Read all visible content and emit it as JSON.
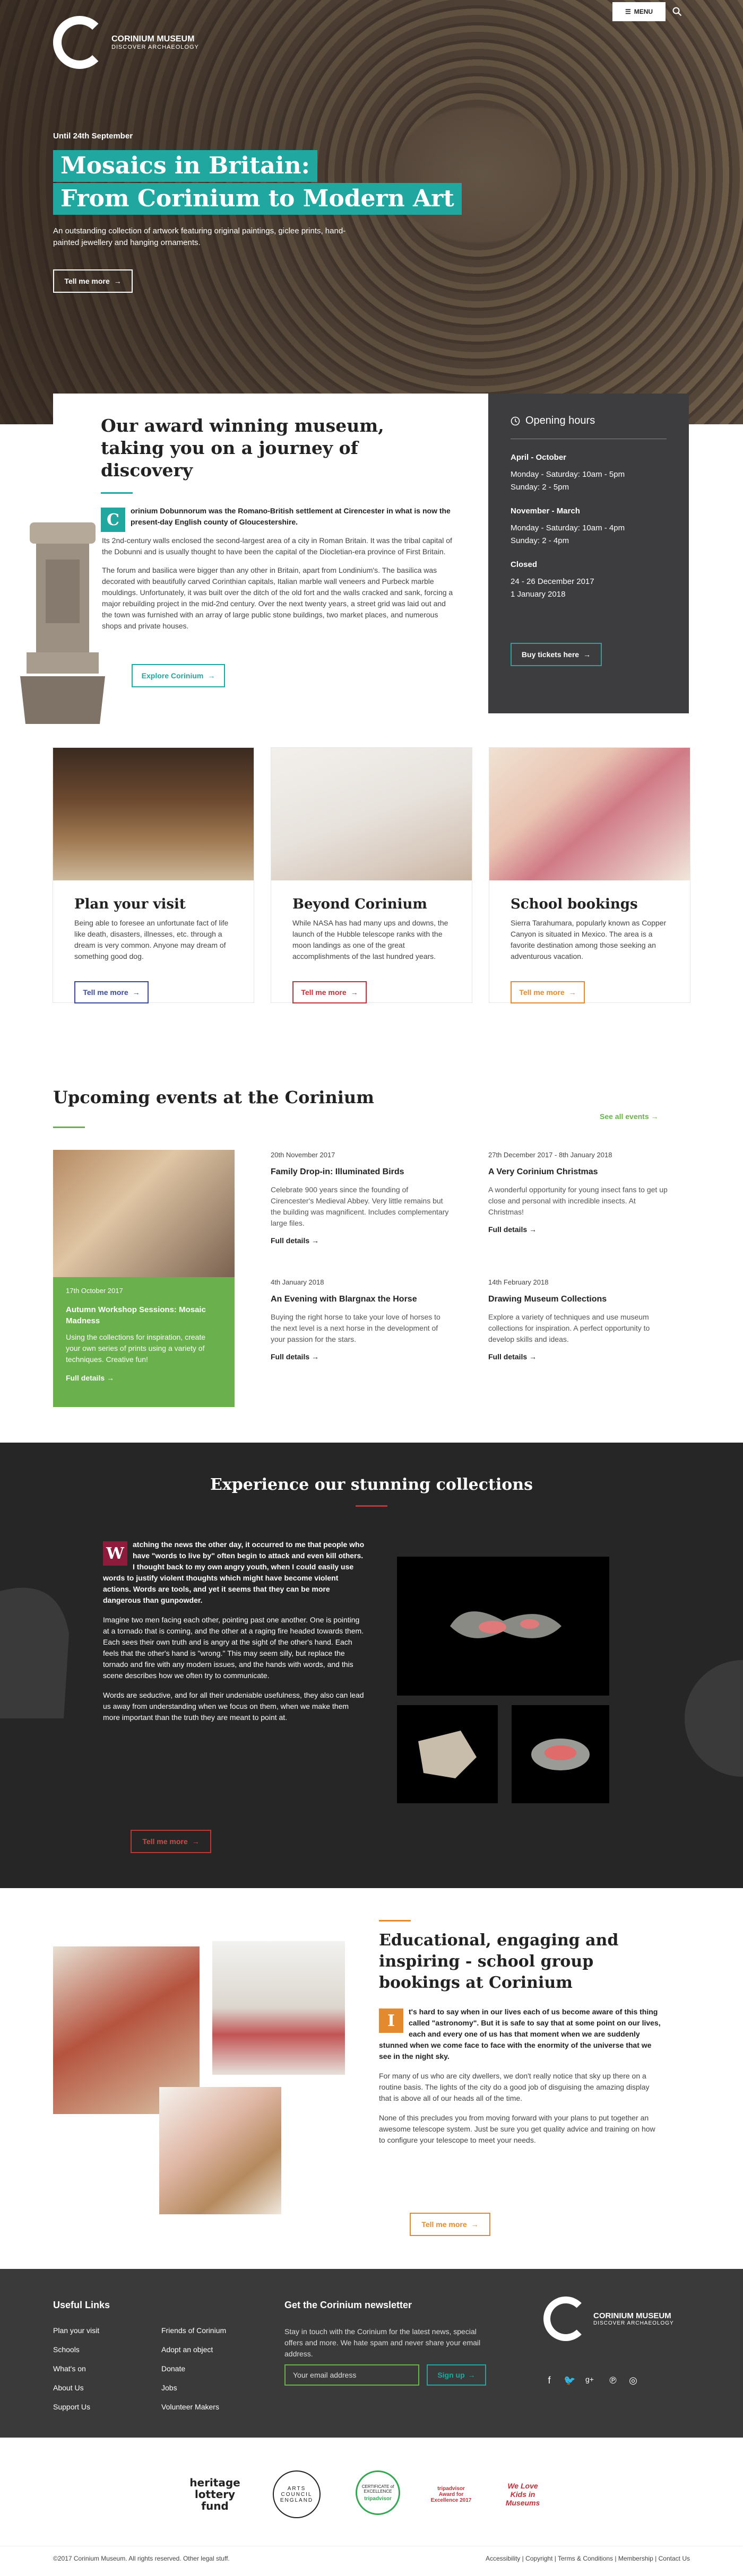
{
  "header": {
    "logo_title": "CORINIUM MUSEUM",
    "logo_subtitle": "DISCOVER ARCHAEOLOGY",
    "menu_label": "MENU"
  },
  "hero": {
    "date": "Until 24th September",
    "title_line1": "Mosaics in Britain:",
    "title_line2": "From Corinium to Modern Art",
    "description": "An outstanding collection of artwork featuring original paintings, giclee prints, hand-painted jewellery and hanging ornaments.",
    "button": "Tell me more"
  },
  "intro": {
    "heading": "Our award winning museum, taking you on a journey of discovery",
    "dropcap": "C",
    "lead": "orinium Dobunnorum was the Romano-British settlement at Cirencester in what is now the present-day English county of Gloucestershire.",
    "p2": "Its 2nd-century walls enclosed the second-largest area of a city in Roman Britain. It was the tribal capital of the Dobunni and is usually thought to have been the capital of the Diocletian-era province of First Britain.",
    "p3": "The forum and basilica were bigger than any other in Britain, apart from Londinium's. The basilica was decorated with beautifully carved Corinthian capitals, Italian marble wall veneers and Purbeck marble mouldings. Unfortunately, it was built over the ditch of the old fort and the walls cracked and sank, forcing a major rebuilding project in the mid-2nd century. Over the next twenty years, a street grid was laid out and the town was furnished with an array of large public stone buildings, two market places, and numerous shops and private houses.",
    "button": "Explore Corinium"
  },
  "hours": {
    "title": "Opening hours",
    "groups": [
      {
        "heading": "April - October",
        "lines": [
          "Monday - Saturday: 10am - 5pm",
          "Sunday: 2 - 5pm"
        ]
      },
      {
        "heading": "November - March",
        "lines": [
          "Monday - Saturday: 10am - 4pm",
          "Sunday: 2 - 4pm"
        ]
      },
      {
        "heading": "Closed",
        "lines": [
          "24 - 26 December 2017",
          "1 January 2018"
        ]
      }
    ],
    "button": "Buy tickets here"
  },
  "cards": [
    {
      "title": "Plan your visit",
      "text": "Being able to foresee an unfortunate fact of life like death, disasters, illnesses, etc. through a dream is very common. Anyone may dream of something good dog.",
      "button": "Tell me more",
      "color": "#3a4a9a"
    },
    {
      "title": "Beyond Corinium",
      "text": "While NASA has had many ups and downs, the launch of the Hubble telescope ranks with the moon landings as one of the great accomplishments of the last hundred years.",
      "button": "Tell me more",
      "color": "#c0303b"
    },
    {
      "title": "School bookings",
      "text": "Sierra Tarahumara, popularly known as Copper Canyon is situated in Mexico. The area is a favorite destination among those seeking an adventurous vacation.",
      "button": "Tell me more",
      "color": "#e38a2e"
    }
  ],
  "events": {
    "heading": "Upcoming events at the Corinium",
    "see_all": "See all events",
    "featured": {
      "date": "17th October 2017",
      "title": "Autumn Workshop Sessions: Mosaic Madness",
      "text": "Using the collections for inspiration, create your own series of prints using a variety of techniques. Creative fun!",
      "link": "Full details"
    },
    "items": [
      {
        "date": "20th November 2017",
        "title": "Family Drop-in: Illuminated Birds",
        "text": "Celebrate 900 years since the founding of Cirencester's Medieval Abbey. Very little remains but the building was magnificent. Includes complementary large files.",
        "link": "Full details"
      },
      {
        "date": "27th December 2017 - 8th January 2018",
        "title": "A Very Corinium Christmas",
        "text": "A wonderful opportunity for young insect fans to get up close and personal with incredible insects. At Christmas!",
        "link": "Full details"
      },
      {
        "date": "4th January 2018",
        "title": "An Evening with Blargnax the Horse",
        "text": "Buying the right horse to take your love of horses to the next level is a next horse in the development of your passion for the stars.",
        "link": "Full details"
      },
      {
        "date": "14th February 2018",
        "title": "Drawing Museum Collections",
        "text": "Explore a variety of techniques and use museum collections for inspiration. A perfect opportunity to develop skills and ideas.",
        "link": "Full details"
      }
    ]
  },
  "collections": {
    "heading": "Experience our stunning collections",
    "dropcap": "W",
    "lead": "atching the news the other day, it occurred to me that people who have \"words to live by\" often begin to attack and even kill others. I thought back to my own angry youth, when I could easily use words to justify violent thoughts which might have become violent actions. Words are tools, and yet it seems that they can be more dangerous than gunpowder.",
    "p2": "Imagine two men facing each other, pointing past one another. One is pointing at a tornado that is coming, and the other at a raging fire headed towards them. Each sees their own truth and is angry at the sight of the other's hand. Each feels that the other's hand is \"wrong.\" This may seem silly, but replace the tornado and fire with any modern issues, and the hands with words, and this scene describes how we often try to communicate.",
    "p3": "Words are seductive, and for all their undeniable usefulness, they also can lead us away from understanding when we focus on them, when we make them more important than the truth they are meant to point at.",
    "button": "Tell me more"
  },
  "bookings": {
    "heading": "Educational, engaging and inspiring - school group bookings at Corinium",
    "dropcap": "I",
    "lead": "t's hard to say when in our lives each of us become aware of this thing called \"astronomy\". But it is safe to say that at some point on our lives, each and every one of us has that moment when we are suddenly stunned when we come face to face with the enormity of the universe that we see in the night sky.",
    "p2": "For many of us who are city dwellers, we don't really notice that sky up there on a routine basis. The lights of the city do a good job of disguising the amazing display that is above all of our heads all of the time.",
    "p3": "None of this precludes you from moving forward with your plans to put together an awesome telescope system. Just be sure you get quality advice and training on how to configure your telescope to meet your needs.",
    "button": "Tell me more"
  },
  "footer": {
    "useful_links_title": "Useful Links",
    "col1": [
      "Plan your visit",
      "Schools",
      "What's on",
      "About Us",
      "Support Us"
    ],
    "col2": [
      "Friends of Corinium",
      "Adopt an object",
      "Donate",
      "Jobs",
      "Volunteer Makers"
    ],
    "newsletter_title": "Get the Corinium newsletter",
    "newsletter_text": "Stay in touch with the Corinium for the latest news, special offers and more. We hate spam and never share your email address.",
    "email_placeholder": "Your email address",
    "signup": "Sign up",
    "logo_title": "CORINIUM MUSEUM",
    "logo_subtitle": "DISCOVER ARCHAEOLOGY"
  },
  "partners": {
    "heritage": "heritage lottery fund",
    "arts": "ARTS COUNCIL ENGLAND",
    "trip1": "CERTIFICATE of EXCELLENCE",
    "trip1b": "tripadvisor",
    "trip2": "tripadvisor Award for Excellence 2017",
    "kids": "We Love Kids in Museums"
  },
  "bottom": {
    "copyright": "©2017 Corinium Museum. All rights reserved. Other legal stuff.",
    "links": "Accessibility | Copyright | Terms & Conditions | Membership | Contact Us"
  }
}
